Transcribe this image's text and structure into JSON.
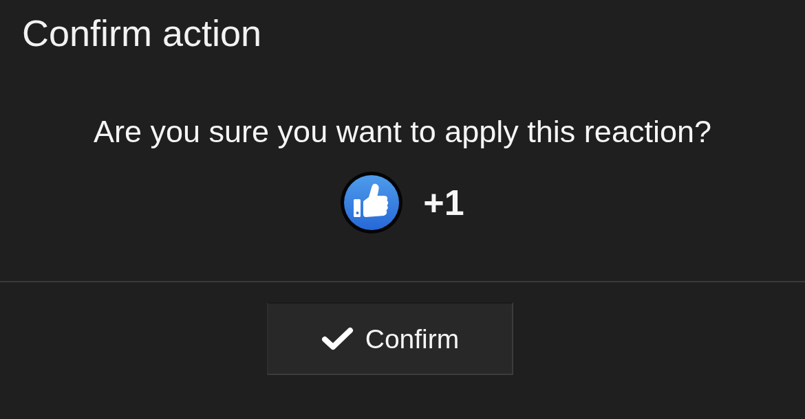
{
  "dialog": {
    "title": "Confirm action",
    "message": "Are you sure you want to apply this reaction?",
    "reaction": {
      "count": "+1"
    },
    "confirm_button": {
      "label": "Confirm"
    }
  }
}
